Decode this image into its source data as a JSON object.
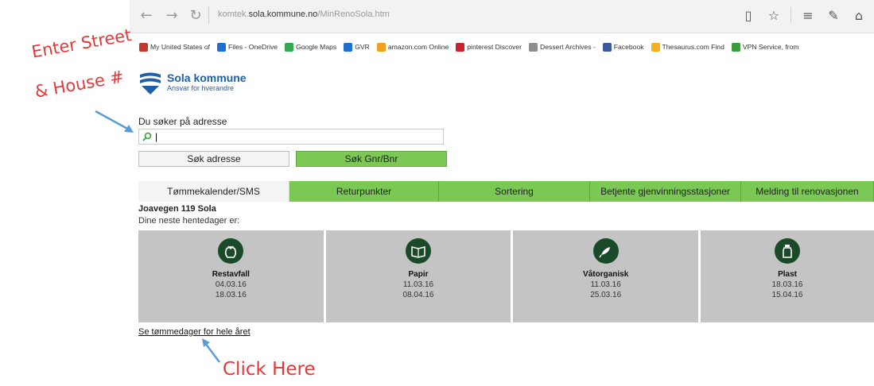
{
  "browser": {
    "url_prefix": "komtek.",
    "url_host": "sola.kommune.no",
    "url_path": "/MinRenoSola.htm",
    "bookmarks": [
      {
        "label": "My United States of",
        "color": "#c0392b"
      },
      {
        "label": "Files - OneDrive",
        "color": "#1e6fd0"
      },
      {
        "label": "Google Maps",
        "color": "#34a853"
      },
      {
        "label": "GVR",
        "color": "#1e6fd0"
      },
      {
        "label": "amazon.com Online",
        "color": "#f0a020"
      },
      {
        "label": "pinterest Discover",
        "color": "#c8232c"
      },
      {
        "label": "Dessert Archives -",
        "color": "#8e8e8e"
      },
      {
        "label": "Facebook",
        "color": "#3b5998"
      },
      {
        "label": "Thesaurus.com Find",
        "color": "#f5b021"
      },
      {
        "label": "VPN Service, from",
        "color": "#3a9d3a"
      }
    ]
  },
  "logo": {
    "title": "Sola kommune",
    "subtitle": "Ansvar for hverandre"
  },
  "search": {
    "label": "Du søker på adresse",
    "value": "|",
    "btn_address": "Søk adresse",
    "btn_gnr": "Søk Gnr/Bnr"
  },
  "tabs": [
    {
      "label": "Tømmekalender/SMS",
      "active": true
    },
    {
      "label": "Returpunkter",
      "active": false
    },
    {
      "label": "Sortering",
      "active": false
    },
    {
      "label": "Betjente gjenvinningsstasjoner",
      "active": false
    },
    {
      "label": "Melding til renovasjonen",
      "active": false
    }
  ],
  "result": {
    "address": "Joavegen 119 Sola",
    "next_days_label": "Dine neste hentedager er:"
  },
  "cards": [
    {
      "name": "Restavfall",
      "icon": "trash-bag-icon",
      "dates": [
        "04.03.16",
        "18.03.16"
      ]
    },
    {
      "name": "Papir",
      "icon": "book-icon",
      "dates": [
        "11.03.16",
        "08.04.16"
      ]
    },
    {
      "name": "Våtorganisk",
      "icon": "food-waste-icon",
      "dates": [
        "11.03.16",
        "25.03.16"
      ]
    },
    {
      "name": "Plast",
      "icon": "plastic-bottle-icon",
      "dates": [
        "18.03.16",
        "15.04.16"
      ]
    }
  ],
  "year_link": "Se tømmedager for hele året",
  "annotations": {
    "street": "Enter Street",
    "house": "& House #",
    "click": "Click Here",
    "color": "#e23a3a",
    "arrow_color": "#5b9bd5"
  }
}
